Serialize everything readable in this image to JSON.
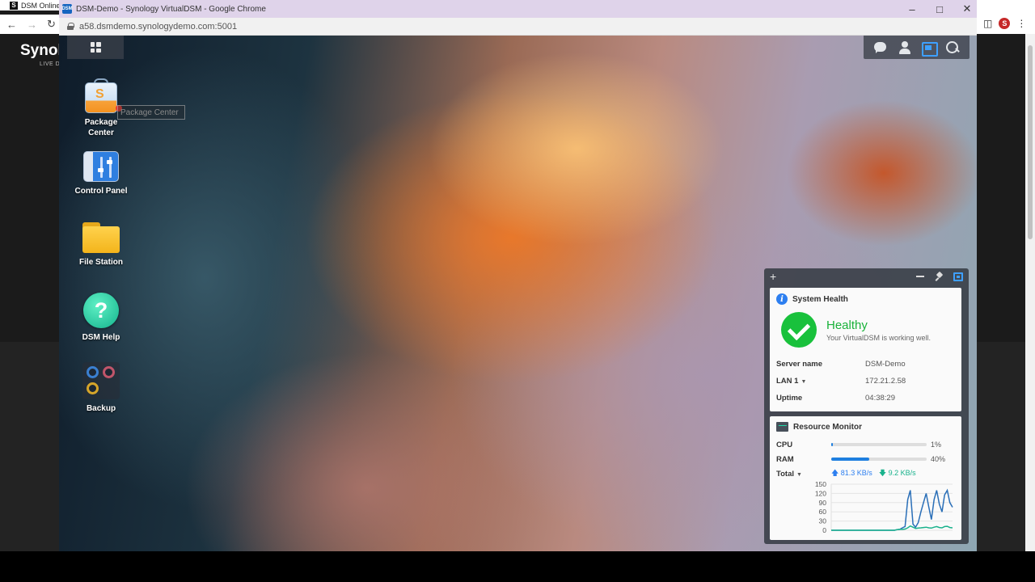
{
  "bg_window": {
    "tab_title": "DSM Online",
    "brand": "Synol",
    "brand_sub": "LIVE DE"
  },
  "chrome": {
    "window_title": "DSM-Demo - Synology VirtualDSM - Google Chrome",
    "url": "a58.dsmdemo.synologydemo.com:5001",
    "favicon_text": "DSM"
  },
  "desktop": {
    "apps": [
      {
        "label": "Package\nCenter"
      },
      {
        "label": "Control Panel"
      },
      {
        "label": "File Station"
      },
      {
        "label": "DSM Help"
      },
      {
        "label": "Backup"
      }
    ],
    "tooltip": "Package Center"
  },
  "system_health": {
    "title": "System Health",
    "status": "Healthy",
    "status_detail": "Your VirtualDSM is working well.",
    "rows": [
      {
        "key": "Server name",
        "value": "DSM-Demo"
      },
      {
        "key": "LAN 1",
        "value": "172.21.2.58"
      },
      {
        "key": "Uptime",
        "value": "04:38:29"
      }
    ],
    "colors": {
      "healthy": "#19c13c",
      "info": "#2d7ff0"
    }
  },
  "resource_monitor": {
    "title": "Resource Monitor",
    "cpu": {
      "label": "CPU",
      "percent": 1,
      "text": "1%"
    },
    "ram": {
      "label": "RAM",
      "percent": 40,
      "text": "40%"
    },
    "total": {
      "label": "Total",
      "upload": "81.3 KB/s",
      "download": "9.2 KB/s"
    }
  },
  "chart_data": {
    "type": "line",
    "title": "",
    "xlabel": "",
    "ylabel": "",
    "yticks": [
      "150",
      "120",
      "90",
      "60",
      "30",
      "0"
    ],
    "ylim": [
      0,
      150
    ],
    "grid": true,
    "series": [
      {
        "values": [
          0,
          0,
          0,
          0,
          0,
          0,
          0,
          0,
          0,
          0,
          0,
          0,
          0,
          0,
          0,
          0,
          0,
          0,
          0,
          0,
          0,
          0,
          0,
          0,
          0,
          2,
          3,
          8,
          12,
          100,
          130,
          20,
          10,
          25,
          60,
          90,
          120,
          75,
          35,
          100,
          130,
          85,
          60,
          115,
          130,
          90,
          75
        ],
        "color": "#2a6fb8"
      },
      {
        "values": [
          0,
          0,
          0,
          0,
          0,
          0,
          0,
          0,
          0,
          0,
          0,
          0,
          0,
          0,
          0,
          0,
          0,
          0,
          0,
          0,
          0,
          0,
          0,
          0,
          0,
          2,
          3,
          3,
          4,
          8,
          14,
          10,
          6,
          7,
          8,
          9,
          10,
          8,
          7,
          10,
          12,
          9,
          8,
          12,
          13,
          9,
          8
        ],
        "color": "#19b28c"
      }
    ]
  }
}
